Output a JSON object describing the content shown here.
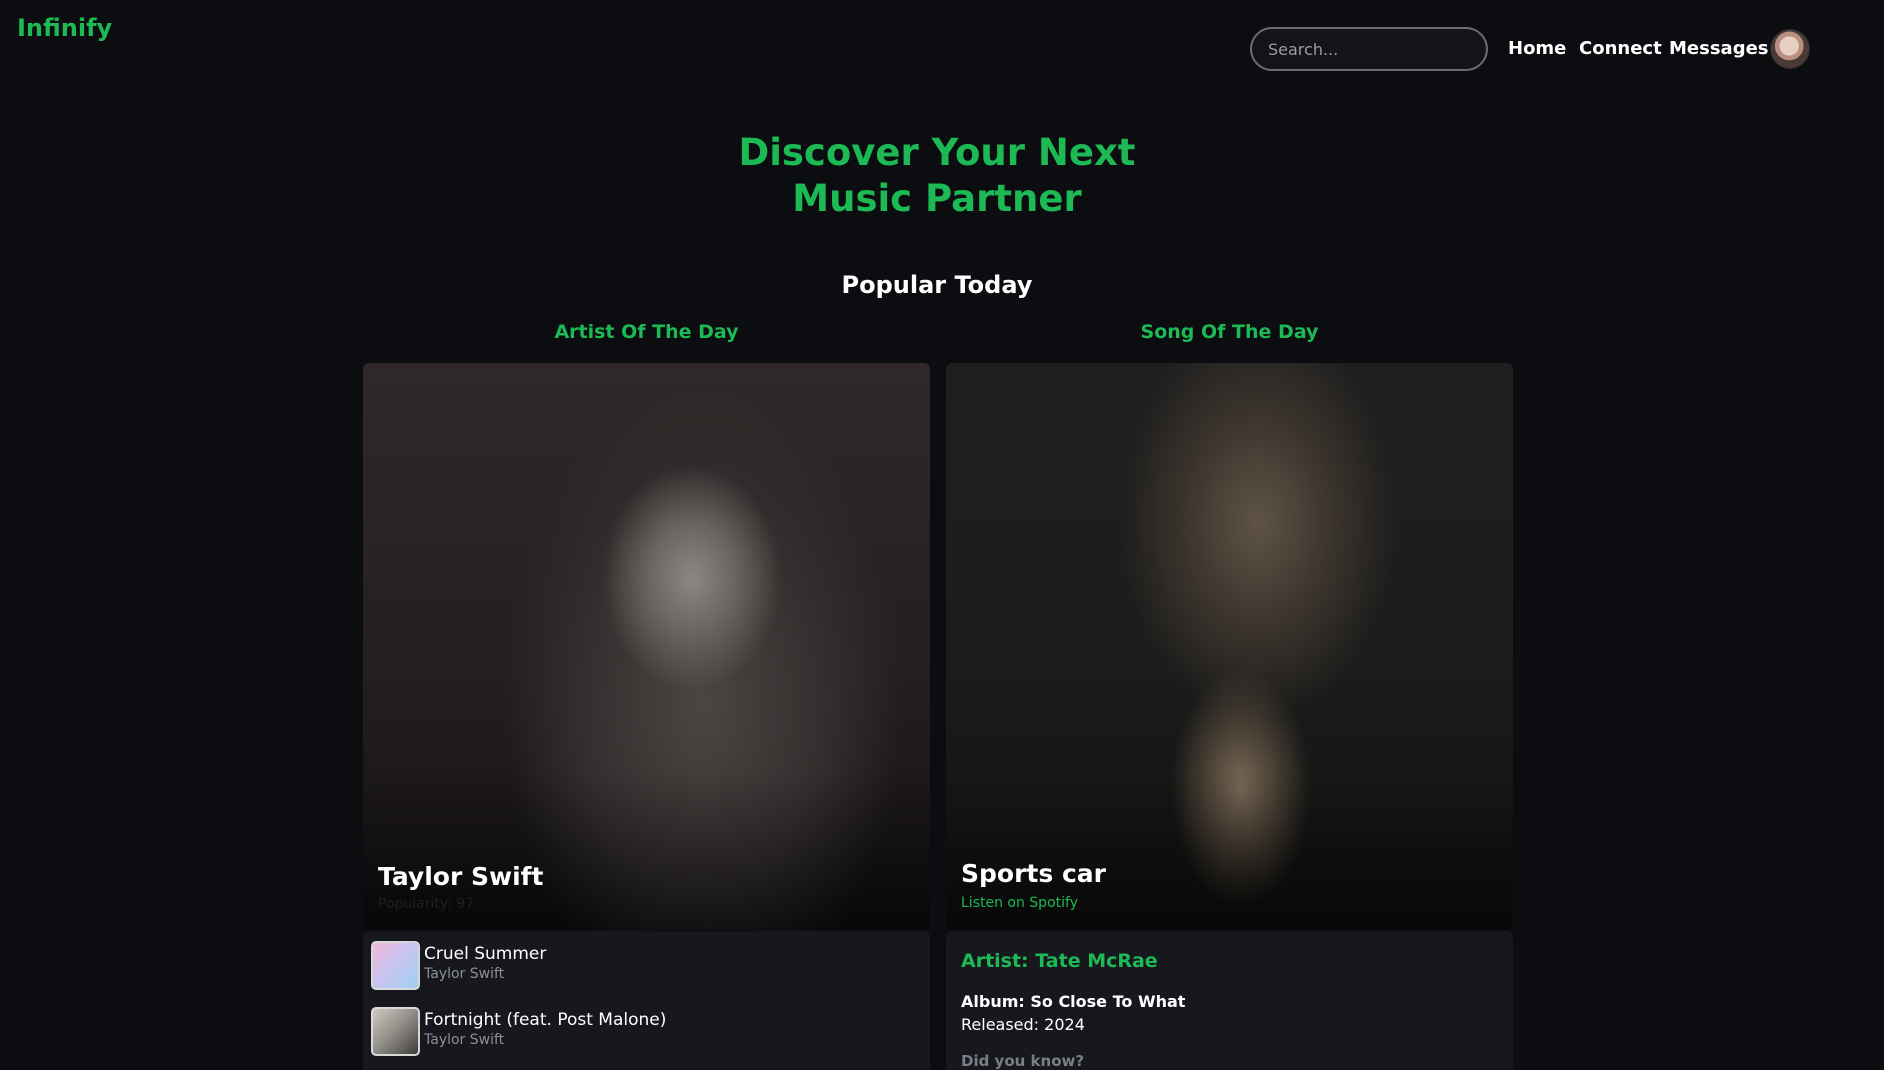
{
  "brand": "Infinify",
  "search": {
    "placeholder": "Search..."
  },
  "nav": {
    "home": "Home",
    "connect": "Connect",
    "messages": "Messages"
  },
  "hero": {
    "line1": "Discover Your Next",
    "line2": "Music Partner"
  },
  "section_title": "Popular Today",
  "artist_of_day": {
    "heading": "Artist Of The Day",
    "name": "Taylor Swift",
    "popularity": "Popularity: 97",
    "top_tracks": [
      {
        "name": "Cruel Summer",
        "artist": "Taylor Swift"
      },
      {
        "name": "Fortnight (feat. Post Malone)",
        "artist": "Taylor Swift"
      }
    ]
  },
  "song_of_day": {
    "heading": "Song Of The Day",
    "title": "Sports car",
    "link": "Listen on Spotify",
    "artist": "Artist: Tate McRae",
    "album": "Album: So Close To What",
    "released": "Released: 2024",
    "did_you_know": "Did you know?"
  },
  "colors": {
    "accent": "#1db954",
    "background": "#0b0d10",
    "panel": "#17181e"
  }
}
